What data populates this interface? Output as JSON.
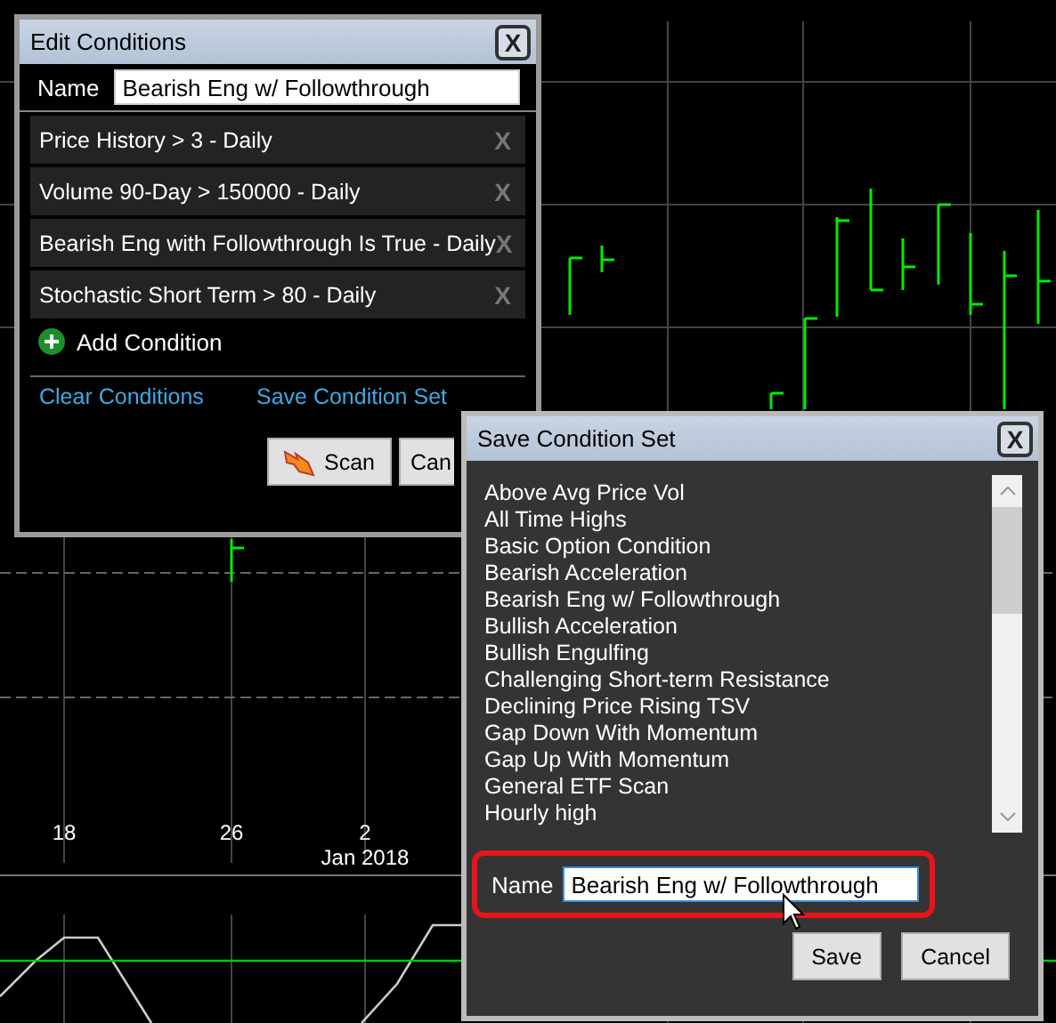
{
  "chart": {
    "x_labels": [
      {
        "label": "18"
      },
      {
        "label": "26"
      },
      {
        "label": "2"
      },
      {
        "label": "Jan 2018"
      }
    ]
  },
  "edit_dialog": {
    "title": "Edit Conditions",
    "close": "X",
    "name_label": "Name",
    "name_value": "Bearish Eng w/ Followthrough",
    "conditions": [
      {
        "text": "Price History > 3 - Daily",
        "remove": "X"
      },
      {
        "text": "Volume 90-Day > 150000 - Daily",
        "remove": "X"
      },
      {
        "text": "Bearish Eng with Followthrough Is True - Daily",
        "remove": "X"
      },
      {
        "text": "Stochastic Short Term > 80 - Daily",
        "remove": "X"
      }
    ],
    "add_label": "Add Condition",
    "clear_link": "Clear Conditions",
    "save_link": "Save Condition Set",
    "buttons": [
      {
        "label": "Scan",
        "kind": "scan"
      },
      {
        "label": "Can",
        "kind": "plain"
      }
    ]
  },
  "save_dialog": {
    "title": "Save Condition Set",
    "close": "X",
    "sets": [
      "Above Avg Price Vol",
      "All Time Highs",
      "Basic Option Condition",
      "Bearish Acceleration",
      "Bearish Eng w/ Followthrough",
      "Bullish Acceleration",
      "Bullish Engulfing",
      "Challenging Short-term Resistance",
      "Declining Price Rising TSV",
      "Gap Down With Momentum",
      "Gap Up With Momentum",
      "General ETF Scan",
      "Hourly high"
    ],
    "name_label": "Name",
    "name_value": "Bearish Eng w/ Followthrough",
    "highlighted": true,
    "buttons": [
      "Save",
      "Cancel"
    ]
  }
}
